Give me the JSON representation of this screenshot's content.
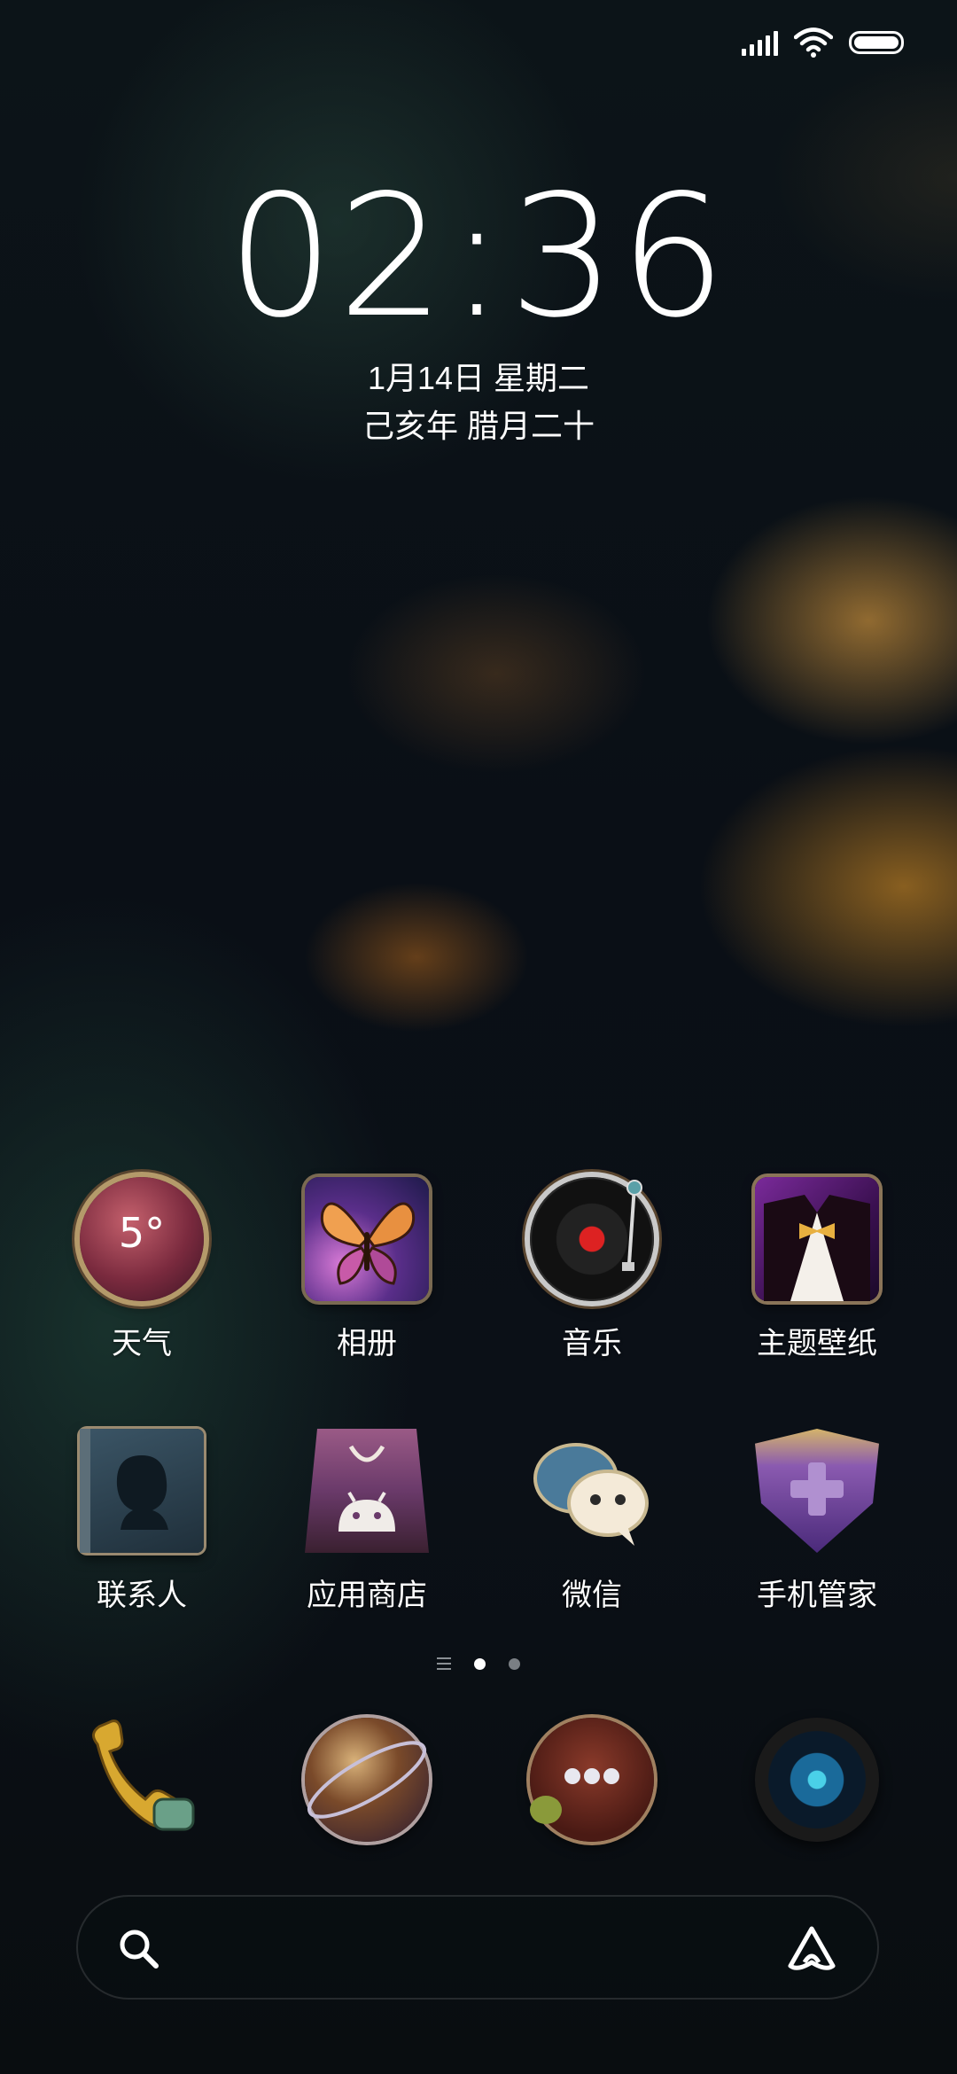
{
  "status_bar": {
    "signal_icon": "signal-bars-icon",
    "wifi_icon": "wifi-icon",
    "battery_icon": "battery-icon"
  },
  "lockclock": {
    "time": "02:36",
    "date": "1月14日 星期二",
    "lunar_date": "己亥年 腊月二十"
  },
  "apps": [
    {
      "label": "天气",
      "icon": "weather-icon",
      "badge_text": "5°"
    },
    {
      "label": "相册",
      "icon": "gallery-butterfly-icon"
    },
    {
      "label": "音乐",
      "icon": "music-record-icon"
    },
    {
      "label": "主题壁纸",
      "icon": "theme-tuxedo-icon"
    },
    {
      "label": "联系人",
      "icon": "contacts-book-icon"
    },
    {
      "label": "应用商店",
      "icon": "app-store-bag-icon"
    },
    {
      "label": "微信",
      "icon": "wechat-bubbles-icon"
    },
    {
      "label": "手机管家",
      "icon": "security-shield-icon"
    }
  ],
  "dock": [
    {
      "icon": "phone-handset-icon"
    },
    {
      "icon": "browser-globe-icon"
    },
    {
      "icon": "messages-bubble-icon"
    },
    {
      "icon": "camera-lens-icon"
    }
  ],
  "page_indicator": {
    "pages": 2,
    "active_index": 0
  },
  "search_bar": {
    "search_icon": "search-icon",
    "assistant_icon": "assistant-icon"
  }
}
